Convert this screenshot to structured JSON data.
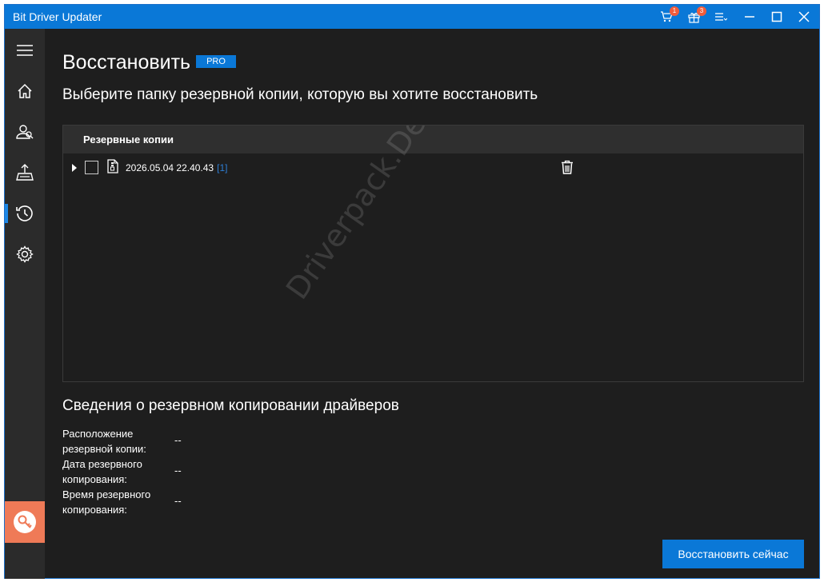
{
  "app": {
    "title": "Bit Driver Updater"
  },
  "titlebar": {
    "cart_badge": "1",
    "gift_badge": "3"
  },
  "sidebar": {
    "items": [
      {
        "name": "menu",
        "icon": "hamburger-icon"
      },
      {
        "name": "home",
        "icon": "home-icon"
      },
      {
        "name": "scan",
        "icon": "user-scan-icon"
      },
      {
        "name": "backup",
        "icon": "backup-icon"
      },
      {
        "name": "restore",
        "icon": "history-icon",
        "active": true
      },
      {
        "name": "settings",
        "icon": "gear-icon"
      }
    ],
    "key_icon": "key-icon"
  },
  "page": {
    "title": "Восстановить",
    "badge": "PRO",
    "subtitle": "Выберите папку резервной копии, которую вы хотите восстановить"
  },
  "backups": {
    "header": "Резервные копии",
    "rows": [
      {
        "name": "2026.05.04 22.40.43",
        "count": "[1]"
      }
    ]
  },
  "watermark": "Driverpack.Dev",
  "info": {
    "title": "Сведения о резервном копировании драйверов",
    "fields": [
      {
        "label": "Расположение резервной копии:",
        "value": "--"
      },
      {
        "label": "Дата резервного копирования:",
        "value": "--"
      },
      {
        "label": "Время резервного копирования:",
        "value": "--"
      }
    ]
  },
  "actions": {
    "restore_now": "Восстановить сейчас"
  },
  "colors": {
    "accent": "#0a78d7",
    "key_button": "#ef7a57",
    "badge": "#f25c3b"
  }
}
